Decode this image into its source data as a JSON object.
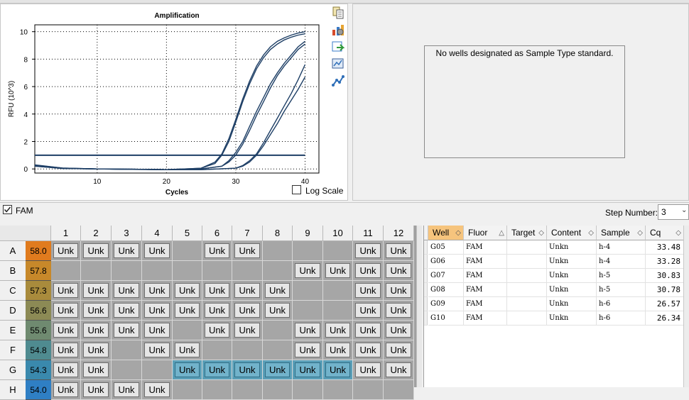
{
  "chart": {
    "title": "Amplification",
    "xlabel": "Cycles",
    "ylabel": "RFU (10^3)",
    "log_scale_label": "Log Scale",
    "log_scale_checked": false
  },
  "chart_data": {
    "type": "line",
    "title": "Amplification",
    "xlabel": "Cycles",
    "ylabel": "RFU (10^3)",
    "xlim": [
      1,
      42
    ],
    "ylim": [
      -0.3,
      10.5
    ],
    "xticks": [
      10,
      20,
      30,
      40
    ],
    "yticks": [
      0,
      2,
      4,
      6,
      8,
      10
    ],
    "grid": true,
    "threshold": 1.0,
    "series": [
      {
        "well": "G05",
        "x": [
          1,
          5,
          10,
          15,
          20,
          25,
          28,
          29,
          30,
          31,
          32,
          33,
          34,
          35,
          36,
          37,
          38,
          39,
          40
        ],
        "y": [
          0.25,
          0.05,
          0.0,
          -0.02,
          -0.05,
          0.0,
          0.2,
          0.5,
          1.0,
          1.8,
          2.8,
          3.9,
          4.9,
          5.9,
          6.8,
          7.5,
          8.1,
          8.7,
          9.1
        ]
      },
      {
        "well": "G06",
        "x": [
          1,
          5,
          10,
          15,
          20,
          25,
          28,
          29,
          30,
          31,
          32,
          33,
          34,
          35,
          36,
          37,
          38,
          39,
          40
        ],
        "y": [
          0.2,
          0.04,
          0.0,
          -0.02,
          -0.05,
          0.0,
          0.2,
          0.6,
          1.2,
          2.0,
          3.1,
          4.2,
          5.2,
          6.2,
          7.0,
          7.7,
          8.3,
          8.9,
          9.3
        ]
      },
      {
        "well": "G07",
        "x": [
          1,
          5,
          10,
          15,
          20,
          25,
          27,
          28,
          29,
          30,
          31,
          32,
          33,
          34,
          35,
          36,
          37,
          38,
          39,
          40
        ],
        "y": [
          0.3,
          0.06,
          0.0,
          -0.03,
          -0.05,
          0.05,
          0.4,
          1.0,
          2.0,
          3.4,
          4.9,
          6.2,
          7.3,
          8.1,
          8.7,
          9.1,
          9.4,
          9.6,
          9.75,
          9.85
        ]
      },
      {
        "well": "G08",
        "x": [
          1,
          5,
          10,
          15,
          20,
          25,
          27,
          28,
          29,
          30,
          31,
          32,
          33,
          34,
          35,
          36,
          37,
          38,
          39,
          40
        ],
        "y": [
          0.28,
          0.06,
          0.0,
          -0.03,
          -0.05,
          0.05,
          0.5,
          1.1,
          2.2,
          3.6,
          5.1,
          6.4,
          7.5,
          8.3,
          8.9,
          9.3,
          9.55,
          9.75,
          9.9,
          10.0
        ]
      },
      {
        "well": "G09",
        "x": [
          1,
          5,
          10,
          15,
          20,
          25,
          30,
          31,
          32,
          33,
          34,
          35,
          36,
          37,
          38,
          39,
          40
        ],
        "y": [
          0.2,
          0.03,
          0.0,
          -0.02,
          -0.05,
          -0.05,
          0.05,
          0.2,
          0.5,
          1.0,
          1.7,
          2.5,
          3.3,
          4.2,
          5.0,
          5.8,
          6.7
        ]
      },
      {
        "well": "G10",
        "x": [
          1,
          5,
          10,
          15,
          20,
          25,
          30,
          31,
          32,
          33,
          34,
          35,
          36,
          37,
          38,
          39,
          40
        ],
        "y": [
          0.22,
          0.03,
          0.0,
          -0.02,
          -0.05,
          -0.05,
          0.05,
          0.25,
          0.6,
          1.1,
          1.9,
          2.8,
          3.7,
          4.6,
          5.5,
          6.5,
          7.6
        ]
      }
    ]
  },
  "toolbar": {
    "icons": [
      "copy-icon",
      "chart-properties-icon",
      "export-icon",
      "zoom-icon",
      "line-style-icon"
    ]
  },
  "std_panel": {
    "message": "No wells designated as Sample Type standard."
  },
  "filter": {
    "fam_label": "FAM",
    "fam_checked": true,
    "step_label": "Step Number:",
    "step_value": "3"
  },
  "plate": {
    "columns": [
      "1",
      "2",
      "3",
      "4",
      "5",
      "6",
      "7",
      "8",
      "9",
      "10",
      "11",
      "12"
    ],
    "rows": [
      {
        "label": "A",
        "temp": "58.0",
        "temp_color": "#e07b1e",
        "wells": [
          "Unk",
          "Unk",
          "Unk",
          "Unk",
          "",
          "Unk",
          "Unk",
          "",
          "",
          "",
          "Unk",
          "Unk"
        ]
      },
      {
        "label": "B",
        "temp": "57.8",
        "temp_color": "#c7882a",
        "wells": [
          "",
          "",
          "",
          "",
          "",
          "",
          "",
          "",
          "Unk",
          "Unk",
          "Unk",
          "Unk"
        ]
      },
      {
        "label": "C",
        "temp": "57.3",
        "temp_color": "#a98b3c",
        "wells": [
          "Unk",
          "Unk",
          "Unk",
          "Unk",
          "Unk",
          "Unk",
          "Unk",
          "Unk",
          "",
          "",
          "Unk",
          "Unk"
        ]
      },
      {
        "label": "D",
        "temp": "56.6",
        "temp_color": "#8c8a55",
        "wells": [
          "Unk",
          "Unk",
          "Unk",
          "Unk",
          "Unk",
          "Unk",
          "Unk",
          "Unk",
          "",
          "",
          "Unk",
          "Unk"
        ]
      },
      {
        "label": "E",
        "temp": "55.6",
        "temp_color": "#6f8a70",
        "wells": [
          "Unk",
          "Unk",
          "Unk",
          "Unk",
          "",
          "Unk",
          "Unk",
          "",
          "Unk",
          "Unk",
          "Unk",
          "Unk"
        ]
      },
      {
        "label": "F",
        "temp": "54.8",
        "temp_color": "#4f8b90",
        "wells": [
          "Unk",
          "Unk",
          "",
          "Unk",
          "Unk",
          "",
          "",
          "",
          "Unk",
          "Unk",
          "Unk",
          "Unk"
        ]
      },
      {
        "label": "G",
        "temp": "54.3",
        "temp_color": "#3a89ad",
        "wells": [
          "Unk",
          "Unk",
          "",
          "",
          "Unk",
          "Unk",
          "Unk",
          "Unk",
          "Unk",
          "Unk",
          "Unk",
          "Unk"
        ],
        "selected": [
          4,
          5,
          6,
          7,
          8,
          9
        ]
      },
      {
        "label": "H",
        "temp": "54.0",
        "temp_color": "#2f7fc4",
        "wells": [
          "Unk",
          "Unk",
          "Unk",
          "Unk",
          "",
          "",
          "",
          "",
          "",
          "",
          "",
          ""
        ]
      }
    ]
  },
  "table": {
    "headers": [
      "Well",
      "Fluor",
      "Target",
      "Content",
      "Sample",
      "Cq"
    ],
    "rows": [
      [
        "G05",
        "FAM",
        "",
        "Unkn",
        "h-4",
        "33.48"
      ],
      [
        "G06",
        "FAM",
        "",
        "Unkn",
        "h-4",
        "33.28"
      ],
      [
        "G07",
        "FAM",
        "",
        "Unkn",
        "h-5",
        "30.83"
      ],
      [
        "G08",
        "FAM",
        "",
        "Unkn",
        "h-5",
        "30.78"
      ],
      [
        "G09",
        "FAM",
        "",
        "Unkn",
        "h-6",
        "26.57"
      ],
      [
        "G10",
        "FAM",
        "",
        "Unkn",
        "h-6",
        "26.34"
      ]
    ]
  },
  "colors": {
    "curve": "#1e3f66",
    "selected_well": "#5a9fb8",
    "sorted_header": "#f6c47d"
  }
}
